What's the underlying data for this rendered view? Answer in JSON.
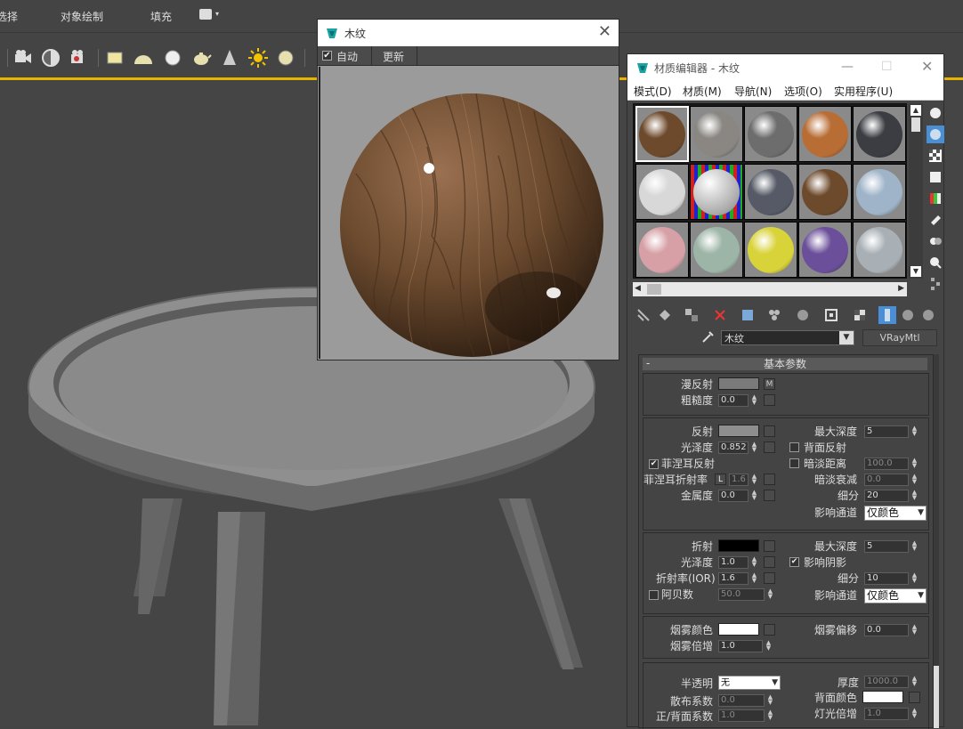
{
  "menubar": {
    "items": [
      "选择",
      "对象绘制",
      "填充"
    ]
  },
  "preview_window": {
    "title": "木纹",
    "auto_label": "自动",
    "auto_checked": true,
    "update_label": "更新",
    "close_glyph": "✕"
  },
  "material_editor": {
    "title": "材质编辑器 - 木纹",
    "menus": [
      "模式(D)",
      "材质(M)",
      "导航(N)",
      "选项(O)",
      "实用程序(U)"
    ],
    "material_name": "木纹",
    "material_type": "VRayMtl",
    "rollout_title": "基本参数",
    "rollout_toggle": "-",
    "diffuse": {
      "label": "漫反射",
      "map_button": "M",
      "roughness_label": "粗糙度",
      "roughness": "0.0"
    },
    "reflection": {
      "label": "反射",
      "gloss_label": "光泽度",
      "gloss": "0.852",
      "fresnel_label": "菲涅耳反射",
      "fresnel_checked": true,
      "fresnel_ior_label": "菲涅耳折射率",
      "fresnel_ior_lock": "L",
      "fresnel_ior": "1.6",
      "metalness_label": "金属度",
      "metalness": "0.0",
      "max_depth_label": "最大深度",
      "max_depth": "5",
      "back_reflect_label": "背面反射",
      "dim_distance_label": "暗淡距离",
      "dim_distance": "100.0",
      "dim_falloff_label": "暗淡衰减",
      "dim_falloff": "0.0",
      "subdivs_label": "细分",
      "subdivs": "20",
      "affect_channels_label": "影响通道",
      "affect_channels": "仅颜色"
    },
    "refraction": {
      "label": "折射",
      "gloss_label": "光泽度",
      "gloss": "1.0",
      "ior_label": "折射率(IOR)",
      "ior": "1.6",
      "abbe_label": "阿贝数",
      "abbe": "50.0",
      "max_depth_label": "最大深度",
      "max_depth": "5",
      "affect_shadows_label": "影响阴影",
      "affect_shadows_checked": true,
      "subdivs_label": "细分",
      "subdivs": "10",
      "affect_channels_label": "影响通道",
      "affect_channels": "仅颜色"
    },
    "fog": {
      "color_label": "烟雾颜色",
      "multiplier_label": "烟雾倍增",
      "multiplier": "1.0",
      "bias_label": "烟雾偏移",
      "bias": "0.0"
    },
    "translucency": {
      "label": "半透明",
      "value": "无",
      "scatter_label": "散布系数",
      "scatter": "0.0",
      "fwd_back_label": "正/背面系数",
      "fwd_back": "1.0",
      "thickness_label": "厚度",
      "thickness": "1000.0",
      "back_color_label": "背面颜色",
      "light_mult_label": "灯光倍增",
      "light_mult": "1.0"
    },
    "slot_colors": [
      "#6e4a2c",
      "#8a8782",
      "#6d6d6d",
      "#b86d35",
      "#3b3d42",
      "#d8d8d8",
      "checker",
      "#555a66",
      "#6e4a2c",
      "#9fb4c9",
      "#d6a0a6",
      "#9cb5a6",
      "#d9d33a",
      "#6b4f9a",
      "#a9b0b5"
    ]
  },
  "colors": {
    "accent_yellow": "#e8b400",
    "selected_tool": "#4a8fd6"
  }
}
